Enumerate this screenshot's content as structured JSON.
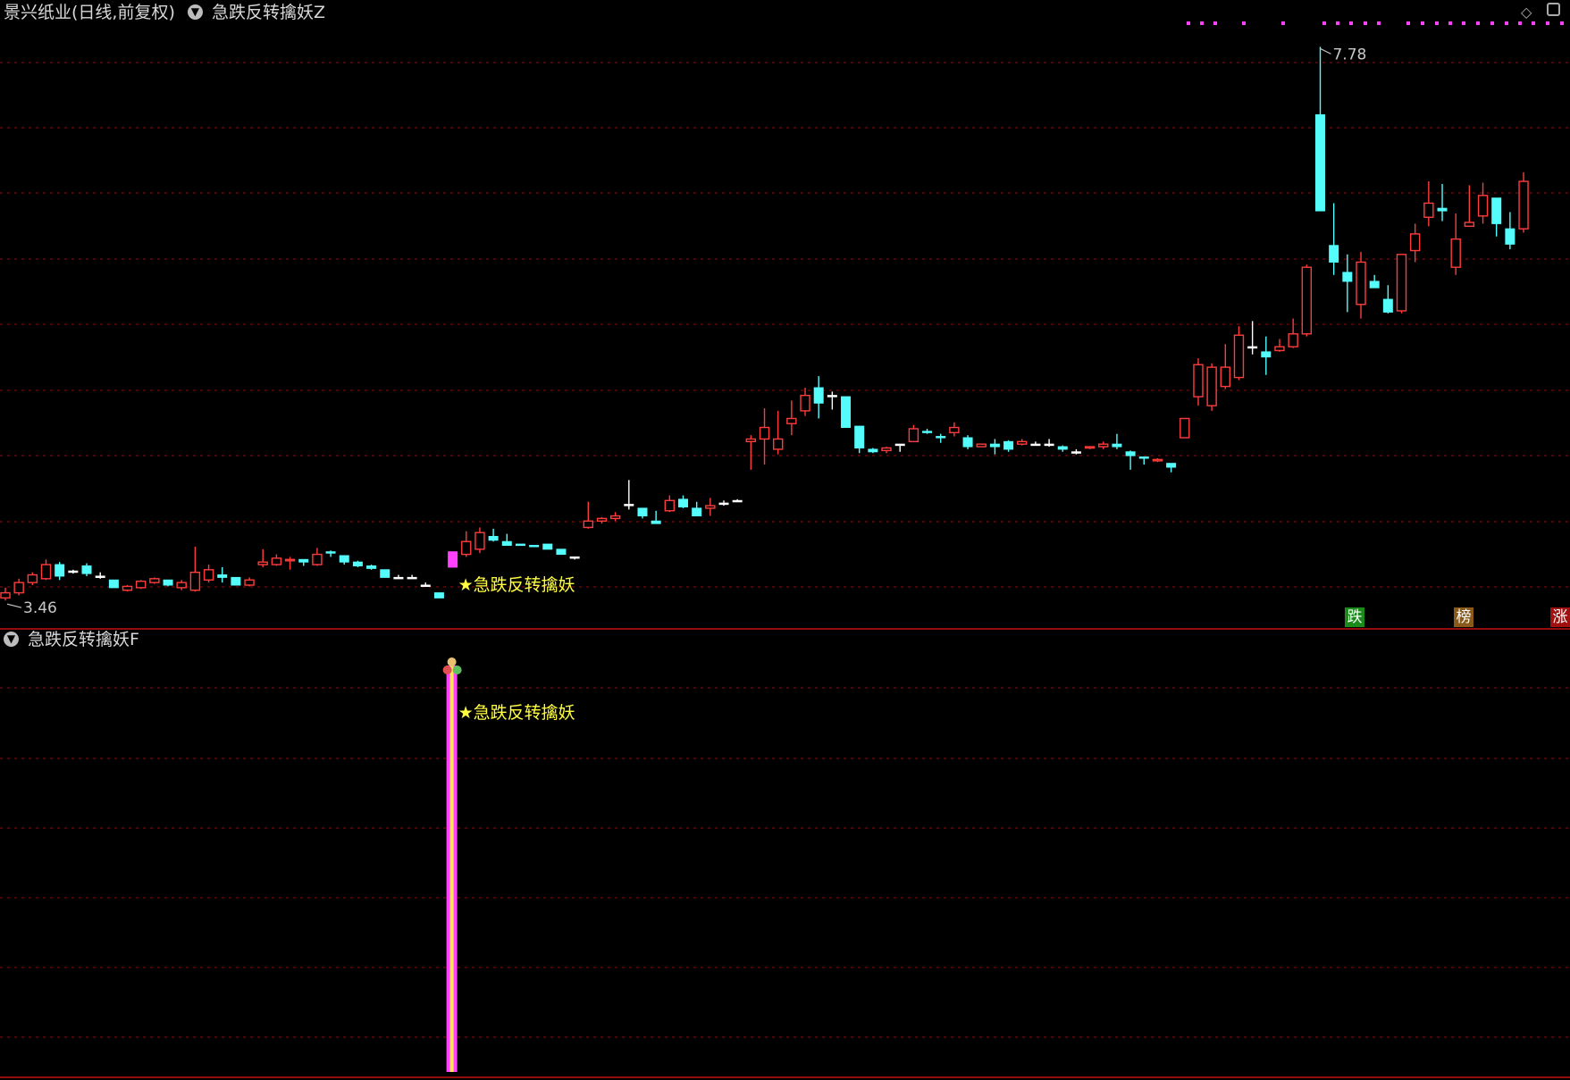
{
  "header": {
    "stock_title": "景兴纸业(日线,前复权)",
    "indicator_main": "急跌反转擒妖Z",
    "indicator_sub": "急跌反转擒妖F"
  },
  "icons": {
    "dropdown": "chevron-down-icon",
    "diamond": "diamond-icon",
    "panel": "panel-toggle-icon"
  },
  "badges": [
    {
      "label": "跌",
      "color": "#1a8a1a"
    },
    {
      "label": "榜",
      "color": "#8a5a1a"
    },
    {
      "label": "涨",
      "color": "#a01010"
    }
  ],
  "colors": {
    "up": "#ff3c3c",
    "down": "#54fcfc",
    "doji": "#ffffff",
    "grid": "#8a1010",
    "separator": "#c81010",
    "signal_text": "#ffff40",
    "signal_bar": "#ff40ff",
    "dots": "#ff40ff"
  },
  "chart_data": {
    "type": "candlestick",
    "price_labels": {
      "max": "7.78",
      "min": "3.46"
    },
    "ylim": [
      3.35,
      7.95
    ],
    "grid": true,
    "signal": {
      "label": "★急跌反转擒妖",
      "index": 33
    },
    "sub_signal": {
      "label": "★急跌反转擒妖",
      "index": 33
    },
    "candles": [
      [
        3.48,
        3.56,
        3.46,
        3.52
      ],
      [
        3.52,
        3.63,
        3.5,
        3.6
      ],
      [
        3.6,
        3.68,
        3.58,
        3.66
      ],
      [
        3.63,
        3.78,
        3.62,
        3.74
      ],
      [
        3.74,
        3.76,
        3.62,
        3.65
      ],
      [
        3.69,
        3.7,
        3.67,
        3.69
      ],
      [
        3.73,
        3.75,
        3.65,
        3.67
      ],
      [
        3.65,
        3.68,
        3.63,
        3.65
      ],
      [
        3.62,
        3.62,
        3.56,
        3.56
      ],
      [
        3.54,
        3.58,
        3.53,
        3.57
      ],
      [
        3.56,
        3.62,
        3.55,
        3.61
      ],
      [
        3.6,
        3.64,
        3.59,
        3.63
      ],
      [
        3.62,
        3.62,
        3.57,
        3.58
      ],
      [
        3.56,
        3.62,
        3.54,
        3.6
      ],
      [
        3.54,
        3.88,
        3.53,
        3.68
      ],
      [
        3.62,
        3.74,
        3.6,
        3.7
      ],
      [
        3.66,
        3.72,
        3.6,
        3.64
      ],
      [
        3.64,
        3.64,
        3.58,
        3.58
      ],
      [
        3.58,
        3.64,
        3.57,
        3.62
      ],
      [
        3.74,
        3.86,
        3.72,
        3.76
      ],
      [
        3.74,
        3.82,
        3.73,
        3.79
      ],
      [
        3.77,
        3.8,
        3.7,
        3.78
      ],
      [
        3.78,
        3.78,
        3.73,
        3.76
      ],
      [
        3.74,
        3.87,
        3.73,
        3.82
      ],
      [
        3.84,
        3.85,
        3.8,
        3.83
      ],
      [
        3.81,
        3.81,
        3.74,
        3.76
      ],
      [
        3.76,
        3.77,
        3.72,
        3.73
      ],
      [
        3.73,
        3.74,
        3.7,
        3.71
      ],
      [
        3.7,
        3.7,
        3.64,
        3.64
      ],
      [
        3.64,
        3.66,
        3.64,
        3.64
      ],
      [
        3.64,
        3.66,
        3.64,
        3.64
      ],
      [
        3.58,
        3.6,
        3.58,
        3.58
      ],
      [
        3.52,
        3.52,
        3.48,
        3.48
      ],
      [
        3.72,
        3.84,
        3.72,
        3.84
      ],
      [
        3.82,
        4.0,
        3.8,
        3.92
      ],
      [
        3.86,
        4.03,
        3.83,
        3.99
      ],
      [
        3.96,
        4.02,
        3.92,
        3.93
      ],
      [
        3.92,
        3.98,
        3.89,
        3.89
      ],
      [
        3.9,
        3.9,
        3.89,
        3.89
      ],
      [
        3.89,
        3.89,
        3.88,
        3.88
      ],
      [
        3.9,
        3.9,
        3.86,
        3.86
      ],
      [
        3.86,
        3.86,
        3.82,
        3.82
      ],
      [
        3.8,
        3.8,
        3.78,
        3.8
      ],
      [
        4.03,
        4.23,
        4.02,
        4.08
      ],
      [
        4.08,
        4.11,
        4.06,
        4.1
      ],
      [
        4.1,
        4.15,
        4.08,
        4.12
      ],
      [
        4.21,
        4.4,
        4.17,
        4.21
      ],
      [
        4.18,
        4.18,
        4.1,
        4.12
      ],
      [
        4.08,
        4.16,
        4.06,
        4.06
      ],
      [
        4.16,
        4.28,
        4.15,
        4.24
      ],
      [
        4.25,
        4.28,
        4.18,
        4.19
      ],
      [
        4.18,
        4.23,
        4.12,
        4.12
      ],
      [
        4.18,
        4.26,
        4.12,
        4.2
      ],
      [
        4.22,
        4.24,
        4.2,
        4.22
      ],
      [
        4.24,
        4.25,
        4.23,
        4.24
      ],
      [
        4.7,
        4.75,
        4.48,
        4.72
      ],
      [
        4.72,
        4.96,
        4.52,
        4.81
      ],
      [
        4.64,
        4.94,
        4.6,
        4.72
      ],
      [
        4.84,
        5.02,
        4.75,
        4.88
      ],
      [
        4.94,
        5.12,
        4.9,
        5.06
      ],
      [
        5.12,
        5.21,
        4.88,
        5.0
      ],
      [
        5.06,
        5.09,
        4.95,
        5.06
      ],
      [
        5.05,
        5.05,
        4.81,
        4.81
      ],
      [
        4.82,
        4.82,
        4.61,
        4.65
      ],
      [
        4.64,
        4.65,
        4.61,
        4.62
      ],
      [
        4.63,
        4.66,
        4.61,
        4.65
      ],
      [
        4.68,
        4.68,
        4.62,
        4.68
      ],
      [
        4.7,
        4.83,
        4.7,
        4.8
      ],
      [
        4.78,
        4.8,
        4.76,
        4.77
      ],
      [
        4.74,
        4.76,
        4.69,
        4.73
      ],
      [
        4.77,
        4.85,
        4.74,
        4.81
      ],
      [
        4.73,
        4.75,
        4.64,
        4.66
      ],
      [
        4.66,
        4.68,
        4.67,
        4.68
      ],
      [
        4.68,
        4.72,
        4.6,
        4.66
      ],
      [
        4.7,
        4.71,
        4.62,
        4.64
      ],
      [
        4.68,
        4.72,
        4.67,
        4.7
      ],
      [
        4.68,
        4.7,
        4.67,
        4.68
      ],
      [
        4.68,
        4.72,
        4.66,
        4.68
      ],
      [
        4.66,
        4.67,
        4.62,
        4.64
      ],
      [
        4.62,
        4.64,
        4.6,
        4.62
      ],
      [
        4.65,
        4.66,
        4.64,
        4.66
      ],
      [
        4.66,
        4.7,
        4.64,
        4.68
      ],
      [
        4.68,
        4.76,
        4.64,
        4.66
      ],
      [
        4.62,
        4.63,
        4.48,
        4.59
      ],
      [
        4.58,
        4.58,
        4.52,
        4.57
      ],
      [
        4.55,
        4.57,
        4.54,
        4.56
      ],
      [
        4.53,
        4.53,
        4.46,
        4.5
      ],
      [
        4.73,
        4.88,
        4.73,
        4.88
      ],
      [
        5.05,
        5.35,
        4.98,
        5.3
      ],
      [
        4.98,
        5.31,
        4.94,
        5.28
      ],
      [
        5.13,
        5.46,
        5.11,
        5.28
      ],
      [
        5.2,
        5.6,
        5.18,
        5.53
      ],
      [
        5.44,
        5.64,
        5.38,
        5.44
      ],
      [
        5.4,
        5.52,
        5.22,
        5.36
      ],
      [
        5.41,
        5.5,
        5.4,
        5.44
      ],
      [
        5.44,
        5.66,
        5.43,
        5.54
      ],
      [
        5.54,
        6.08,
        5.52,
        6.06
      ],
      [
        7.25,
        7.78,
        6.5,
        6.5
      ],
      [
        6.23,
        6.56,
        6.0,
        6.1
      ],
      [
        6.02,
        6.16,
        5.71,
        5.95
      ],
      [
        5.77,
        6.18,
        5.66,
        6.1
      ],
      [
        5.95,
        6.0,
        5.9,
        5.9
      ],
      [
        5.81,
        5.92,
        5.7,
        5.71
      ],
      [
        5.72,
        6.16,
        5.7,
        6.16
      ],
      [
        6.19,
        6.4,
        6.1,
        6.32
      ],
      [
        6.45,
        6.73,
        6.38,
        6.56
      ],
      [
        6.52,
        6.71,
        6.42,
        6.5
      ],
      [
        6.06,
        6.48,
        6.0,
        6.28
      ],
      [
        6.38,
        6.7,
        6.38,
        6.41
      ],
      [
        6.46,
        6.72,
        6.4,
        6.62
      ],
      [
        6.6,
        6.6,
        6.3,
        6.4
      ],
      [
        6.36,
        6.49,
        6.2,
        6.24
      ],
      [
        6.36,
        6.8,
        6.33,
        6.73
      ]
    ]
  }
}
